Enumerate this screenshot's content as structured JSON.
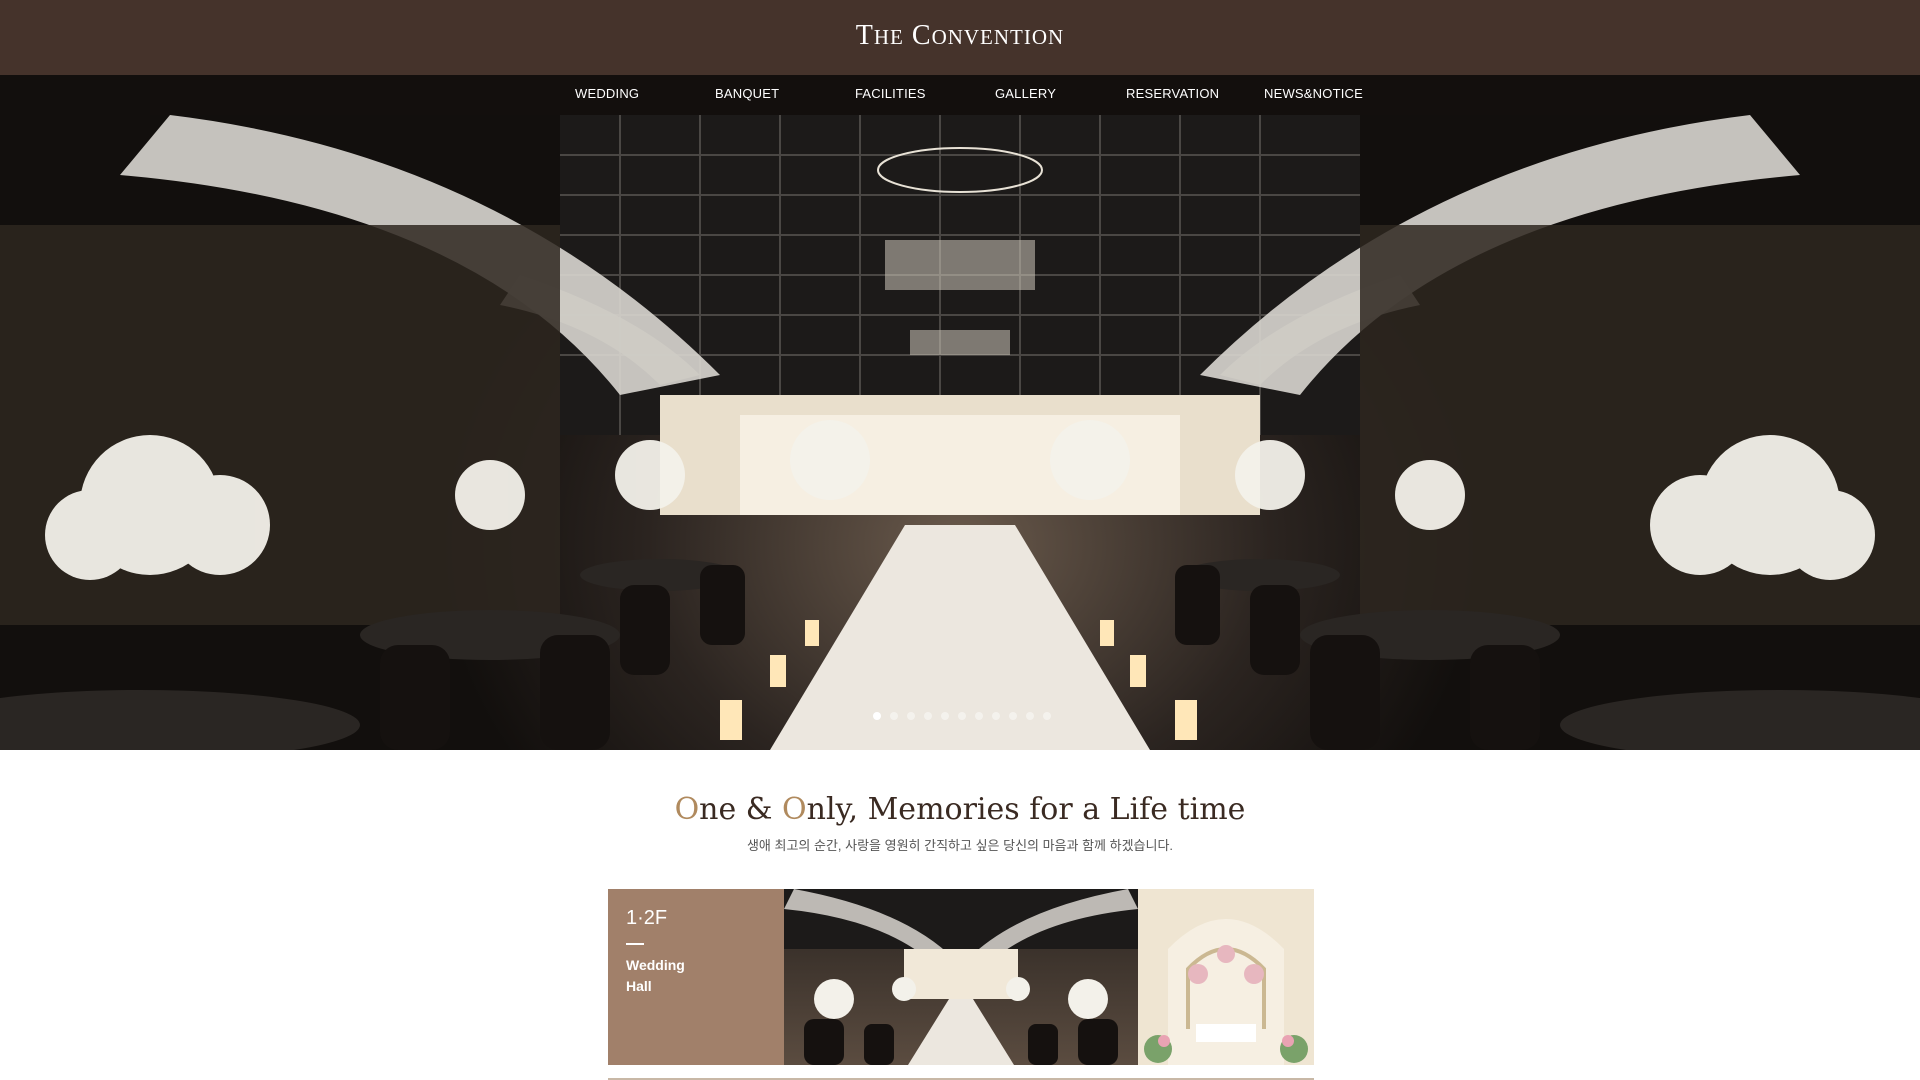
{
  "header": {
    "logo_the": "T",
    "logo_he": "HE",
    "logo_c": "C",
    "logo_onvention": "ONVENTION"
  },
  "nav": {
    "items": [
      "WEDDING",
      "BANQUET",
      "FACILITIES",
      "GALLERY",
      "RESERVATION",
      "NEWS&NOTICE"
    ]
  },
  "slider": {
    "dot_count": 11,
    "active_index": 0
  },
  "intro": {
    "o1": "O",
    "part1": "ne & ",
    "o2": "O",
    "part2": "nly,  Memories for a Life time",
    "subtitle": "생애 최고의 순간, 사랑을 영원히 간직하고 싶은 당신의 마음과 함께 하겠습니다."
  },
  "hall_card": {
    "floor": "1·2F",
    "title_line1": "Wedding",
    "title_line2": "Hall"
  },
  "colors": {
    "header_bg": "#45332b",
    "accent": "#b08a5e",
    "card_bg": "#a1806a"
  }
}
